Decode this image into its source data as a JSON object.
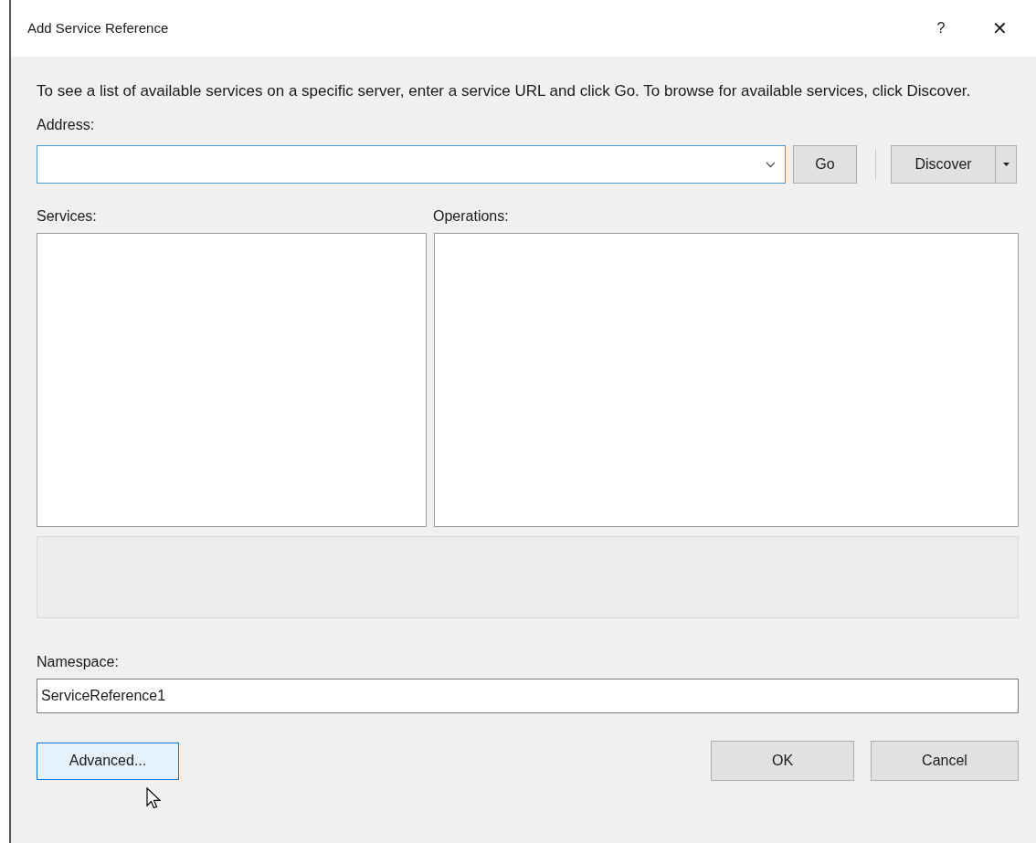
{
  "window": {
    "title": "Add Service Reference",
    "help": "?",
    "close": "✕"
  },
  "description": "To see a list of available services on a specific server, enter a service URL and click Go. To browse for available services, click Discover.",
  "address": {
    "label": "Address:"
  },
  "go_button": "Go",
  "discover_button": {
    "label": "Discover"
  },
  "services": {
    "label": "Services:"
  },
  "operations": {
    "label": "Operations:"
  },
  "namespace": {
    "label": "Namespace:",
    "value": "ServiceReference1"
  },
  "buttons": [
    {
      "label": "Advanced...",
      "kind": "advanced",
      "hovered": true
    },
    {
      "label": "OK",
      "kind": "ok",
      "hovered": false
    },
    {
      "label": "Cancel",
      "kind": "cancel",
      "hovered": false
    }
  ]
}
